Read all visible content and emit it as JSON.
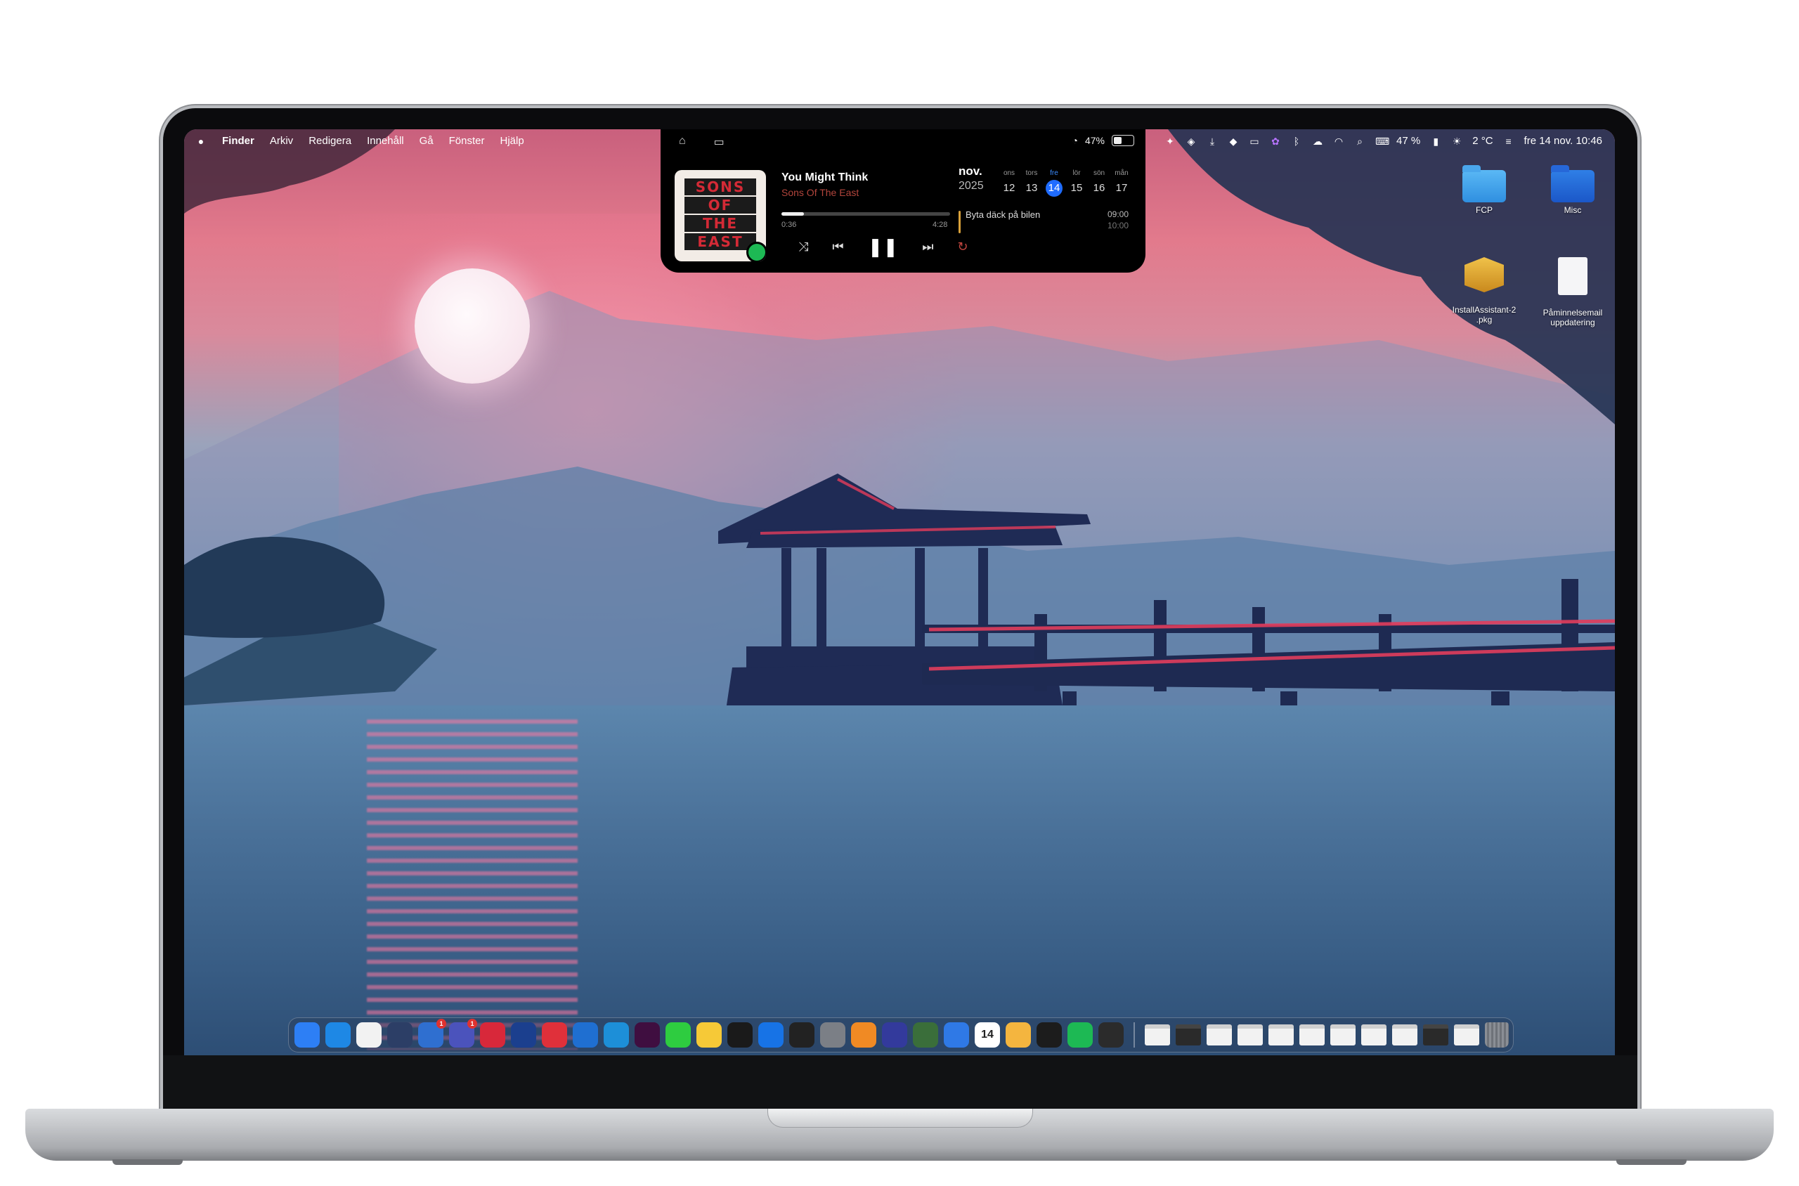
{
  "menubar": {
    "apple": "",
    "app_name": "Finder",
    "menus": [
      "Arkiv",
      "Redigera",
      "Innehåll",
      "Gå",
      "Fönster",
      "Hjälp"
    ],
    "right_items": {
      "battery": "47 %",
      "temperature": "2 °C",
      "datetime": "fre 14 nov. 10:46"
    }
  },
  "notch": {
    "battery_percent": "47%",
    "battery_level": 0.47,
    "player": {
      "album_art_text": [
        "SONS",
        "OF",
        "THE",
        "EAST"
      ],
      "song": "You Might Think",
      "artist": "Sons Of The East",
      "elapsed": "0:36",
      "duration": "4:28",
      "progress": 0.134
    },
    "calendar": {
      "month": "nov.",
      "year": "2025",
      "days": [
        {
          "name": "ons",
          "date": "12"
        },
        {
          "name": "tors",
          "date": "13"
        },
        {
          "name": "fre",
          "date": "14",
          "today": true
        },
        {
          "name": "lör",
          "date": "15"
        },
        {
          "name": "sön",
          "date": "16"
        },
        {
          "name": "mån",
          "date": "17"
        }
      ],
      "event": {
        "title": "Byta däck på bilen",
        "start": "09:00",
        "end": "10:00"
      }
    }
  },
  "desktop_icons": {
    "fcp": "FCP",
    "misc": "Misc",
    "installer": "InstallAssistant-2\n.pkg",
    "reminder": "Påminnelsemail\nuppdatering"
  },
  "dock": {
    "apps": [
      {
        "name": "finder",
        "color": "#2d7ff5"
      },
      {
        "name": "safari",
        "color": "#1e88e5"
      },
      {
        "name": "chrome",
        "color": "#f2f2f2"
      },
      {
        "name": "telegram",
        "color": "#2c3e66"
      },
      {
        "name": "mail",
        "color": "#2f6fd0",
        "badge": "1"
      },
      {
        "name": "teams",
        "color": "#4b53bc",
        "badge": "1"
      },
      {
        "name": "vpn",
        "color": "#d8283a"
      },
      {
        "name": "mac-utility",
        "color": "#1b3f8e"
      },
      {
        "name": "affinity",
        "color": "#e0303a"
      },
      {
        "name": "windows-app",
        "color": "#1f6fd1"
      },
      {
        "name": "dayone",
        "color": "#1d8fd8"
      },
      {
        "name": "slack",
        "color": "#3f0e40"
      },
      {
        "name": "messages",
        "color": "#2ecc40"
      },
      {
        "name": "notes",
        "color": "#f6c937"
      },
      {
        "name": "chatgpt",
        "color": "#1a1a1a"
      },
      {
        "name": "app-store",
        "color": "#1773e6"
      },
      {
        "name": "final-cut",
        "color": "#222222"
      },
      {
        "name": "system-settings",
        "color": "#7b7f86"
      },
      {
        "name": "sublime",
        "color": "#f08a24"
      },
      {
        "name": "screen-sharing",
        "color": "#333a9c"
      },
      {
        "name": "chipmunk",
        "color": "#3a6e3a"
      },
      {
        "name": "things",
        "color": "#2f79e6"
      },
      {
        "name": "calendar",
        "color": "#ffffff",
        "label": "14"
      },
      {
        "name": "photos-like",
        "color": "#f4b53f"
      },
      {
        "name": "terminal",
        "color": "#1c1c1c"
      },
      {
        "name": "spotify",
        "color": "#1db954"
      },
      {
        "name": "activity-monitor",
        "color": "#2b2b2b"
      }
    ],
    "minimized_windows": 11
  }
}
